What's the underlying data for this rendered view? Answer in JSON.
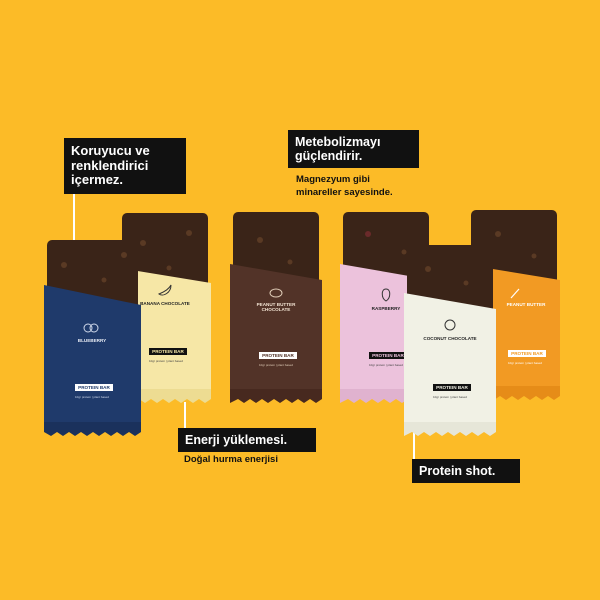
{
  "callouts": {
    "preservatives": "Koruyucu ve renklendirici içermez.",
    "metabolism": "Metebolizmayı güçlendirir.",
    "metabolism_sub": "Magnezyum gibi minareller sayesinde.",
    "energy": "Enerji yüklemesi.",
    "energy_sub": "Doğal hurma enerjisi",
    "protein": "Protein shot."
  },
  "bars": [
    {
      "flavor": "BLUEBERRY",
      "badge": "PROTEIN BAR",
      "fine": "10gr protein | plant based",
      "color": "#1f3a6b",
      "icon": "blueberry-icon"
    },
    {
      "flavor": "BANANA CHOCOLATE",
      "badge": "PROTEIN BAR",
      "fine": "10gr protein | plant based",
      "color": "#f6e7a6",
      "icon": "banana-icon"
    },
    {
      "flavor": "PEANUT BUTTER CHOCOLATE",
      "badge": "PROTEIN BAR",
      "fine": "10gr protein | plant based",
      "color": "#523328",
      "icon": "peanut-icon"
    },
    {
      "flavor": "RASPBERRY",
      "badge": "PROTEIN BAR",
      "fine": "10gr protein | plant based",
      "color": "#ecc2dc",
      "icon": "raspberry-icon"
    },
    {
      "flavor": "COCONUT CHOCOLATE",
      "badge": "PROTEIN BAR",
      "fine": "10gr protein | plant based",
      "color": "#f1f1e5",
      "icon": "coconut-icon"
    },
    {
      "flavor": "PEANUT BUTTER",
      "badge": "PROTEIN BAR",
      "fine": "10gr protein | plant based",
      "color": "#f29a23",
      "icon": "peanut-butter-icon"
    }
  ],
  "colors": {
    "background": "#fcbb27",
    "callout_bg": "#111111",
    "bar_dark": "#3a2418"
  }
}
